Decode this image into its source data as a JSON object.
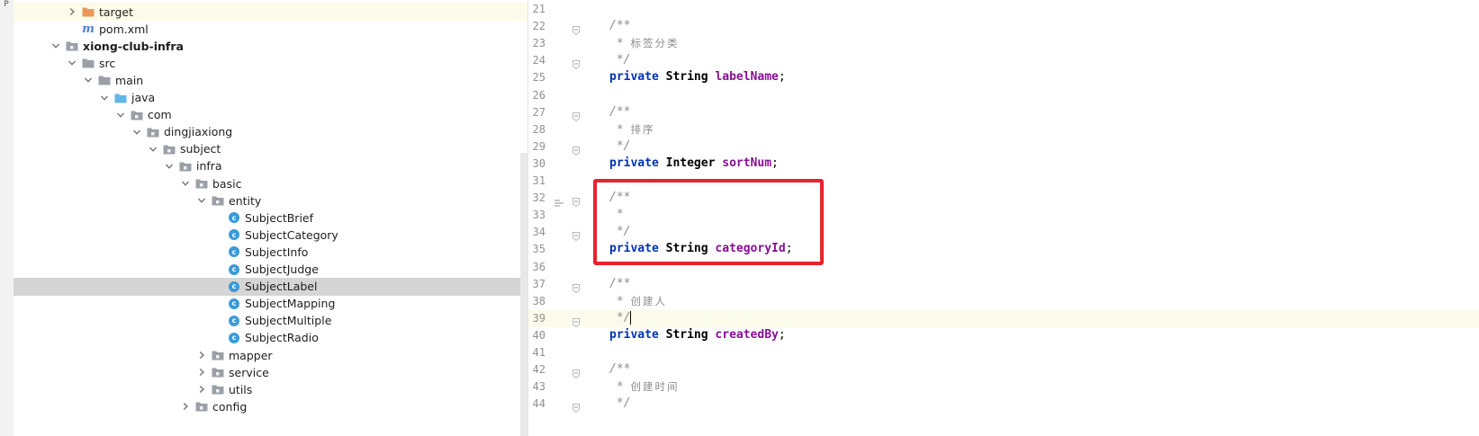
{
  "side_strip": {
    "label": "P"
  },
  "project_tree": {
    "items": [
      {
        "label": "target",
        "indent": 4,
        "expand": "collapsed",
        "icon": "folder-orange-icon",
        "highlight": "yellow"
      },
      {
        "label": "pom.xml",
        "indent": 4,
        "expand": "none",
        "icon": "maven-icon"
      },
      {
        "label": "xiong-club-infra",
        "indent": 3,
        "expand": "expanded",
        "icon": "module-folder-icon",
        "bold": true
      },
      {
        "label": "src",
        "indent": 4,
        "expand": "expanded",
        "icon": "folder-gray-icon"
      },
      {
        "label": "main",
        "indent": 5,
        "expand": "expanded",
        "icon": "folder-gray-icon"
      },
      {
        "label": "java",
        "indent": 6,
        "expand": "expanded",
        "icon": "folder-blue-icon"
      },
      {
        "label": "com",
        "indent": 7,
        "expand": "expanded",
        "icon": "package-icon"
      },
      {
        "label": "dingjiaxiong",
        "indent": 8,
        "expand": "expanded",
        "icon": "package-icon"
      },
      {
        "label": "subject",
        "indent": 9,
        "expand": "expanded",
        "icon": "package-icon"
      },
      {
        "label": "infra",
        "indent": 10,
        "expand": "expanded",
        "icon": "package-icon"
      },
      {
        "label": "basic",
        "indent": 11,
        "expand": "expanded",
        "icon": "package-icon"
      },
      {
        "label": "entity",
        "indent": 12,
        "expand": "expanded",
        "icon": "package-icon"
      },
      {
        "label": "SubjectBrief",
        "indent": 13,
        "expand": "none",
        "icon": "class-icon"
      },
      {
        "label": "SubjectCategory",
        "indent": 13,
        "expand": "none",
        "icon": "class-icon"
      },
      {
        "label": "SubjectInfo",
        "indent": 13,
        "expand": "none",
        "icon": "class-icon"
      },
      {
        "label": "SubjectJudge",
        "indent": 13,
        "expand": "none",
        "icon": "class-icon"
      },
      {
        "label": "SubjectLabel",
        "indent": 13,
        "expand": "none",
        "icon": "class-icon",
        "highlight": "selected"
      },
      {
        "label": "SubjectMapping",
        "indent": 13,
        "expand": "none",
        "icon": "class-icon"
      },
      {
        "label": "SubjectMultiple",
        "indent": 13,
        "expand": "none",
        "icon": "class-icon"
      },
      {
        "label": "SubjectRadio",
        "indent": 13,
        "expand": "none",
        "icon": "class-icon"
      },
      {
        "label": "mapper",
        "indent": 12,
        "expand": "collapsed",
        "icon": "package-icon"
      },
      {
        "label": "service",
        "indent": 12,
        "expand": "collapsed",
        "icon": "package-icon"
      },
      {
        "label": "utils",
        "indent": 12,
        "expand": "collapsed",
        "icon": "package-icon"
      },
      {
        "label": "config",
        "indent": 11,
        "expand": "collapsed",
        "icon": "package-icon"
      }
    ]
  },
  "editor": {
    "lines": [
      {
        "num": "21",
        "fold": false,
        "tokens": []
      },
      {
        "num": "22",
        "fold": true,
        "tokens": [
          [
            "cmt",
            "/**"
          ]
        ]
      },
      {
        "num": "23",
        "fold": false,
        "tokens": [
          [
            "cmt",
            " * "
          ],
          [
            "cmt-cjk",
            "标签分类"
          ]
        ]
      },
      {
        "num": "24",
        "fold": true,
        "tokens": [
          [
            "cmt",
            " */"
          ]
        ]
      },
      {
        "num": "25",
        "fold": false,
        "tokens": [
          [
            "kw",
            "private "
          ],
          [
            "type",
            "String "
          ],
          [
            "field",
            "labelName"
          ],
          [
            "plain",
            ";"
          ]
        ]
      },
      {
        "num": "26",
        "fold": false,
        "tokens": []
      },
      {
        "num": "27",
        "fold": true,
        "tokens": [
          [
            "cmt",
            "/**"
          ]
        ]
      },
      {
        "num": "28",
        "fold": false,
        "tokens": [
          [
            "cmt",
            " * "
          ],
          [
            "cmt-cjk",
            "排序"
          ]
        ]
      },
      {
        "num": "29",
        "fold": true,
        "tokens": [
          [
            "cmt",
            " */"
          ]
        ]
      },
      {
        "num": "30",
        "fold": false,
        "tokens": [
          [
            "kw",
            "private "
          ],
          [
            "type",
            "Integer "
          ],
          [
            "field",
            "sortNum"
          ],
          [
            "plain",
            ";"
          ]
        ]
      },
      {
        "num": "31",
        "fold": false,
        "tokens": []
      },
      {
        "num": "32",
        "fold": true,
        "bookmark": true,
        "tokens": [
          [
            "cmt",
            "/**"
          ]
        ]
      },
      {
        "num": "33",
        "fold": false,
        "tokens": [
          [
            "cmt",
            " *"
          ]
        ]
      },
      {
        "num": "34",
        "fold": true,
        "tokens": [
          [
            "cmt",
            " */"
          ]
        ]
      },
      {
        "num": "35",
        "fold": false,
        "tokens": [
          [
            "kw",
            "private "
          ],
          [
            "type",
            "String "
          ],
          [
            "field",
            "categoryId"
          ],
          [
            "plain",
            ";"
          ]
        ]
      },
      {
        "num": "36",
        "fold": false,
        "tokens": []
      },
      {
        "num": "37",
        "fold": true,
        "tokens": [
          [
            "cmt",
            "/**"
          ]
        ]
      },
      {
        "num": "38",
        "fold": false,
        "tokens": [
          [
            "cmt",
            " * "
          ],
          [
            "cmt-cjk",
            "创建人"
          ]
        ]
      },
      {
        "num": "39",
        "fold": true,
        "caret": true,
        "tokens": [
          [
            "cmt",
            " */"
          ]
        ]
      },
      {
        "num": "40",
        "fold": false,
        "tokens": [
          [
            "kw",
            "private "
          ],
          [
            "type",
            "String "
          ],
          [
            "field",
            "createdBy"
          ],
          [
            "plain",
            ";"
          ]
        ]
      },
      {
        "num": "41",
        "fold": false,
        "tokens": []
      },
      {
        "num": "42",
        "fold": true,
        "tokens": [
          [
            "cmt",
            "/**"
          ]
        ]
      },
      {
        "num": "43",
        "fold": false,
        "tokens": [
          [
            "cmt",
            " * "
          ],
          [
            "cmt-cjk",
            "创建时间"
          ]
        ]
      },
      {
        "num": "44",
        "fold": true,
        "tokens": [
          [
            "cmt",
            " */"
          ]
        ]
      }
    ]
  },
  "colors": {
    "keyword": "#0033b3",
    "field": "#871094",
    "comment": "#8c8c8c",
    "highlight_box": "#e8232b",
    "selected_row": "#d5d5d5"
  }
}
